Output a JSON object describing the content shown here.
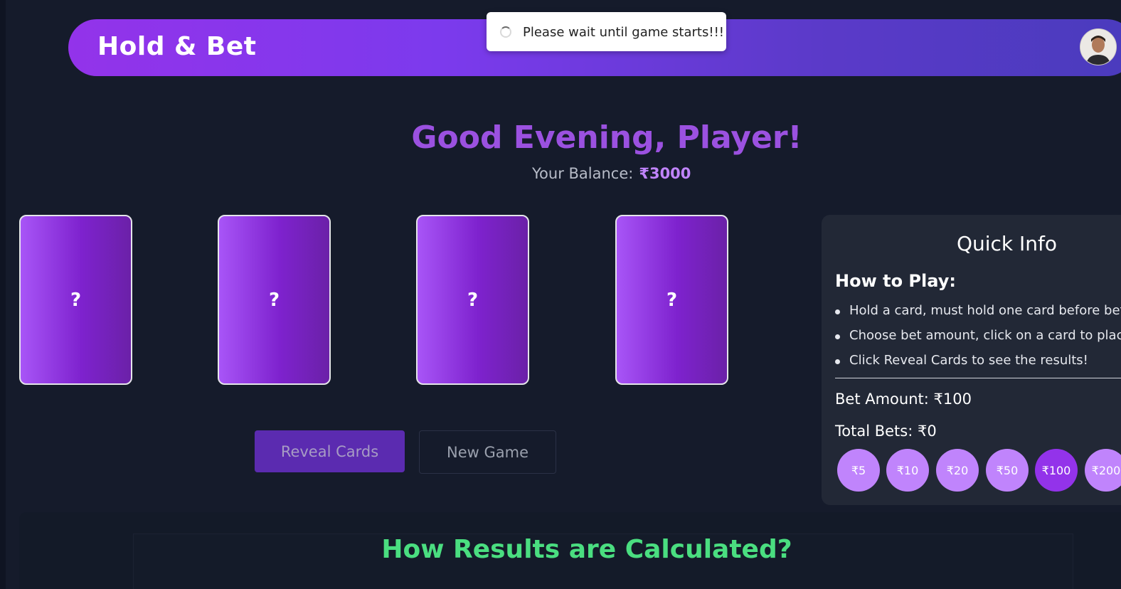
{
  "header": {
    "brand": "Hold & Bet"
  },
  "toast": {
    "message": "Please wait until game starts!!!"
  },
  "greeting": "Good Evening, Player!",
  "balance": {
    "label": "Your Balance:",
    "value": "₹3000"
  },
  "cards": [
    {
      "face": "?"
    },
    {
      "face": "?"
    },
    {
      "face": "?"
    },
    {
      "face": "?"
    }
  ],
  "actions": {
    "reveal_label": "Reveal Cards",
    "new_game_label": "New Game"
  },
  "quick_info": {
    "title": "Quick Info",
    "how_to_title": "How to Play:",
    "rules": [
      "Hold a card, must hold one card before bet",
      "Choose bet amount, click on a card to place",
      "Click Reveal Cards to see the results!"
    ],
    "bet_amount": "Bet Amount: ₹100",
    "total_bets": "Total Bets: ₹0",
    "chips": [
      "₹5",
      "₹10",
      "₹20",
      "₹50",
      "₹100",
      "₹200"
    ],
    "selected_chip": "₹100"
  },
  "results": {
    "title": "How Results are Calculated?"
  },
  "colors": {
    "accent": "#9333ea",
    "chip": "#c084fc",
    "results_title": "#4ade80"
  }
}
